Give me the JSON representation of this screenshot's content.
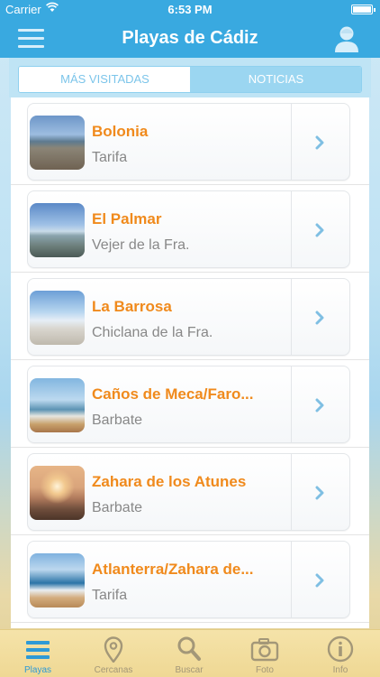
{
  "status_bar": {
    "carrier": "Carrier",
    "time": "6:53 PM"
  },
  "nav": {
    "title": "Playas de Cádiz"
  },
  "segment": {
    "left": "MÁS VISITADAS",
    "right": "NOTICIAS"
  },
  "beaches": [
    {
      "name": "Bolonia",
      "town": "Tarifa",
      "thumb": "bolonia-photo"
    },
    {
      "name": "El Palmar",
      "town": "Vejer de la Fra.",
      "thumb": "el-palmar-photo"
    },
    {
      "name": "La Barrosa",
      "town": "Chiclana de la Fra.",
      "thumb": "la-barrosa-photo"
    },
    {
      "name": "Caños de Meca/Faro...",
      "town": "Barbate",
      "thumb": "canos-de-meca-photo"
    },
    {
      "name": "Zahara de los Atunes",
      "town": "Barbate",
      "thumb": "zahara-photo"
    },
    {
      "name": "Atlanterra/Zahara de...",
      "town": "Tarifa",
      "thumb": "atlanterra-photo"
    }
  ],
  "tabs": [
    {
      "label": "Playas",
      "icon": "list-icon",
      "active": true
    },
    {
      "label": "Cercanas",
      "icon": "location-pin-icon",
      "active": false
    },
    {
      "label": "Buscar",
      "icon": "search-icon",
      "active": false
    },
    {
      "label": "Foto",
      "icon": "camera-icon",
      "active": false
    },
    {
      "label": "Info",
      "icon": "info-icon",
      "active": false
    }
  ],
  "colors": {
    "nav_blue": "#39a9e0",
    "title_orange": "#f08a1c",
    "tab_active": "#2e9ad6",
    "tab_inactive": "#a39778"
  }
}
